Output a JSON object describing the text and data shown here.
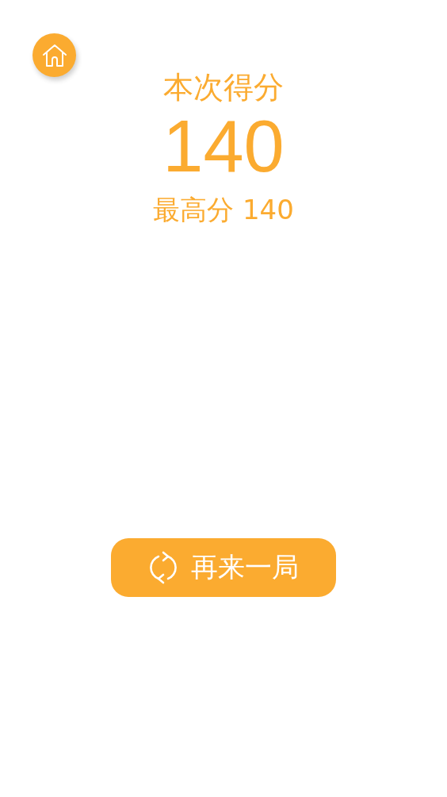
{
  "score_title": "本次得分",
  "score": "140",
  "best_label": "最高分 140",
  "replay_button": {
    "label": "再来一局"
  }
}
